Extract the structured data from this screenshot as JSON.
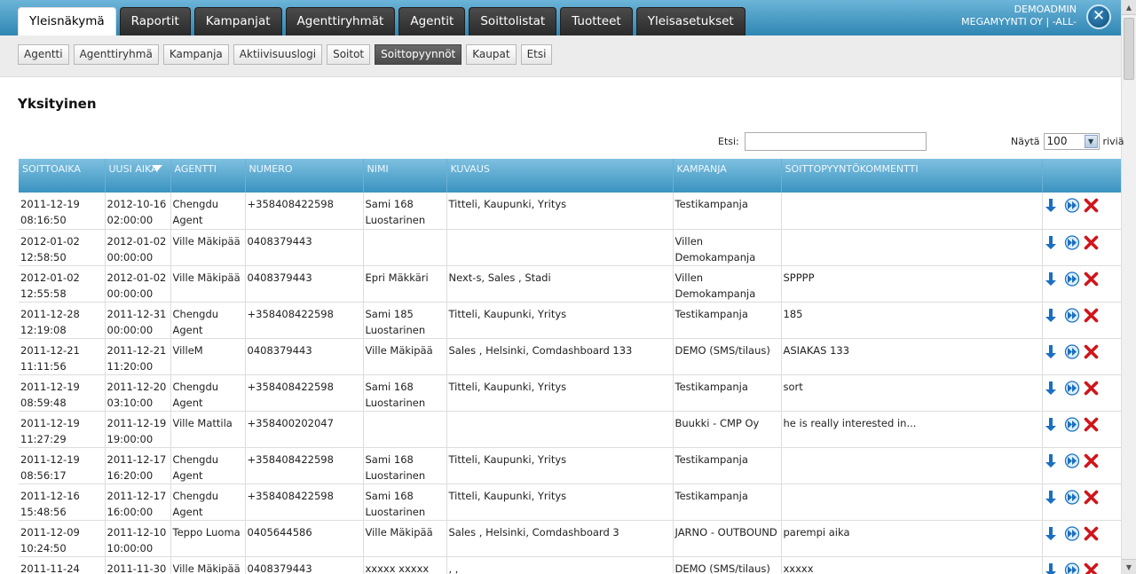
{
  "nav": {
    "tabs": [
      {
        "label": "Yleisnäkymä",
        "active": true
      },
      {
        "label": "Raportit",
        "active": false
      },
      {
        "label": "Kampanjat",
        "active": false
      },
      {
        "label": "Agenttiryhmät",
        "active": false
      },
      {
        "label": "Agentit",
        "active": false
      },
      {
        "label": "Soittolistat",
        "active": false
      },
      {
        "label": "Tuotteet",
        "active": false
      },
      {
        "label": "Yleisasetukset",
        "active": false
      }
    ],
    "user": "DEMOADMIN",
    "company": "MEGAMYYNTI OY | -ALL-",
    "close_label": "✕"
  },
  "subnav": {
    "tabs": [
      {
        "label": "Agentti",
        "active": false
      },
      {
        "label": "Agenttiryhmä",
        "active": false
      },
      {
        "label": "Kampanja",
        "active": false
      },
      {
        "label": "Aktiivisuuslogi",
        "active": false
      },
      {
        "label": "Soitot",
        "active": false
      },
      {
        "label": "Soittopyynnöt",
        "active": true
      },
      {
        "label": "Kaupat",
        "active": false
      },
      {
        "label": "Etsi",
        "active": false
      }
    ]
  },
  "page": {
    "title": "Yksityinen",
    "search_label": "Etsi:",
    "search_value": "",
    "show_label": "Näytä",
    "show_value": "100",
    "rows_label": "riviä"
  },
  "table": {
    "columns": [
      "SOITTOAIKA",
      "UUSI AIKA",
      "AGENTTI",
      "NUMERO",
      "NIMI",
      "KUVAUS",
      "KAMPANJA",
      "SOITTOPYYNTÖKOMMENTTI",
      ""
    ],
    "rows": [
      [
        "2011-12-19 08:16:50",
        "2012-10-16 02:00:00",
        "Chengdu Agent",
        "+358408422598",
        "Sami 168 Luostarinen",
        "Titteli, Kaupunki, Yritys",
        "Testikampanja",
        ""
      ],
      [
        "2012-01-02 12:58:50",
        "2012-01-02 00:00:00",
        "Ville Mäkipää",
        "0408379443",
        "",
        "",
        "Villen Demokampanja",
        ""
      ],
      [
        "2012-01-02 12:55:58",
        "2012-01-02 00:00:00",
        "Ville Mäkipää",
        "0408379443",
        "Epri Mäkkäri",
        "Next-s, Sales , Stadi",
        "Villen Demokampanja",
        "SPPPP"
      ],
      [
        "2011-12-28 12:19:08",
        "2011-12-31 00:00:00",
        "Chengdu Agent",
        "+358408422598",
        "Sami 185 Luostarinen",
        "Titteli, Kaupunki, Yritys",
        "Testikampanja",
        "185"
      ],
      [
        "2011-12-21 11:11:56",
        "2011-12-21 11:20:00",
        "VilleM",
        "0408379443",
        "Ville Mäkipää",
        "Sales , Helsinki, Comdashboard 133",
        "DEMO (SMS/tilaus)",
        "ASIAKAS 133"
      ],
      [
        "2011-12-19 08:59:48",
        "2011-12-20 03:10:00",
        "Chengdu Agent",
        "+358408422598",
        "Sami 168 Luostarinen",
        "Titteli, Kaupunki, Yritys",
        "Testikampanja",
        "sort"
      ],
      [
        "2011-12-19 11:27:29",
        "2011-12-19 19:00:00",
        "Ville Mattila",
        "+358400202047",
        "",
        "",
        "Buukki - CMP Oy",
        "he is really interested in..."
      ],
      [
        "2011-12-19 08:56:17",
        "2011-12-17 16:20:00",
        "Chengdu Agent",
        "+358408422598",
        "Sami 168 Luostarinen",
        "Titteli, Kaupunki, Yritys",
        "Testikampanja",
        ""
      ],
      [
        "2011-12-16 15:48:56",
        "2011-12-17 16:00:00",
        "Chengdu Agent",
        "+358408422598",
        "Sami 168 Luostarinen",
        "Titteli, Kaupunki, Yritys",
        "Testikampanja",
        ""
      ],
      [
        "2011-12-09 10:24:50",
        "2011-12-10 10:00:00",
        "Teppo Luoma",
        "0405644586",
        "Ville Mäkipää",
        "Sales , Helsinki, Comdashboard 3",
        "JARNO - OUTBOUND",
        "parempi aika"
      ],
      [
        "2011-11-24",
        "2011-11-30",
        "Ville Mäkipää",
        "0408379443",
        "xxxxx xxxxx",
        ", ,",
        "DEMO (SMS/tilaus)",
        "xxxxx"
      ]
    ]
  },
  "colors": {
    "header_blue": "#3a93c0",
    "active_subtab": "#555555",
    "delete_red": "#d0151b",
    "action_blue": "#1a6fc0"
  }
}
